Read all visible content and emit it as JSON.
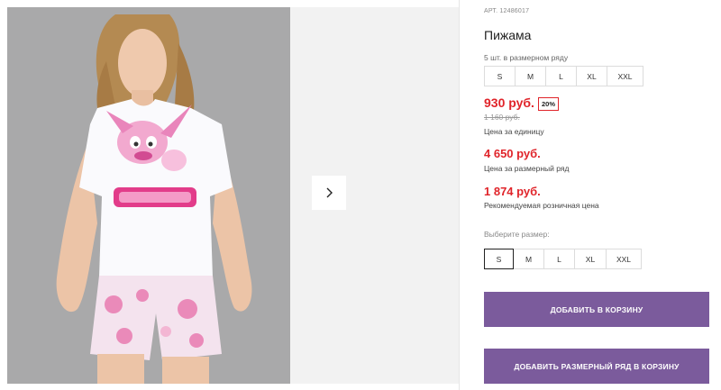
{
  "product": {
    "article": "АРТ. 12486017",
    "title": "Пижама",
    "row_note": "5 шт. в размерном ряду",
    "row_sizes": [
      "S",
      "M",
      "L",
      "XL",
      "XXL"
    ],
    "price": "930 руб.",
    "discount": "20%",
    "old_price": "1 160 руб.",
    "unit_price_label": "Цена за единицу",
    "row_price": "4 650 руб.",
    "row_price_label": "Цена за размерный ряд",
    "retail_price": "1 874 руб.",
    "retail_price_label": "Рекомендуемая розничная цена",
    "choose_size_label": "Выберите размер:",
    "size_options": [
      "S",
      "M",
      "L",
      "XL",
      "XXL"
    ],
    "selected_size": "S"
  },
  "actions": {
    "add_to_cart": "ДОБАВИТЬ В КОРЗИНУ",
    "add_row_to_cart": "ДОБАВИТЬ РАЗМЕРНЫЙ РЯД В КОРЗИНУ"
  },
  "gallery": {
    "next_icon": "chevron-right-icon"
  },
  "colors": {
    "accent_purple": "#7b5b9c",
    "price_red": "#e0242a"
  }
}
